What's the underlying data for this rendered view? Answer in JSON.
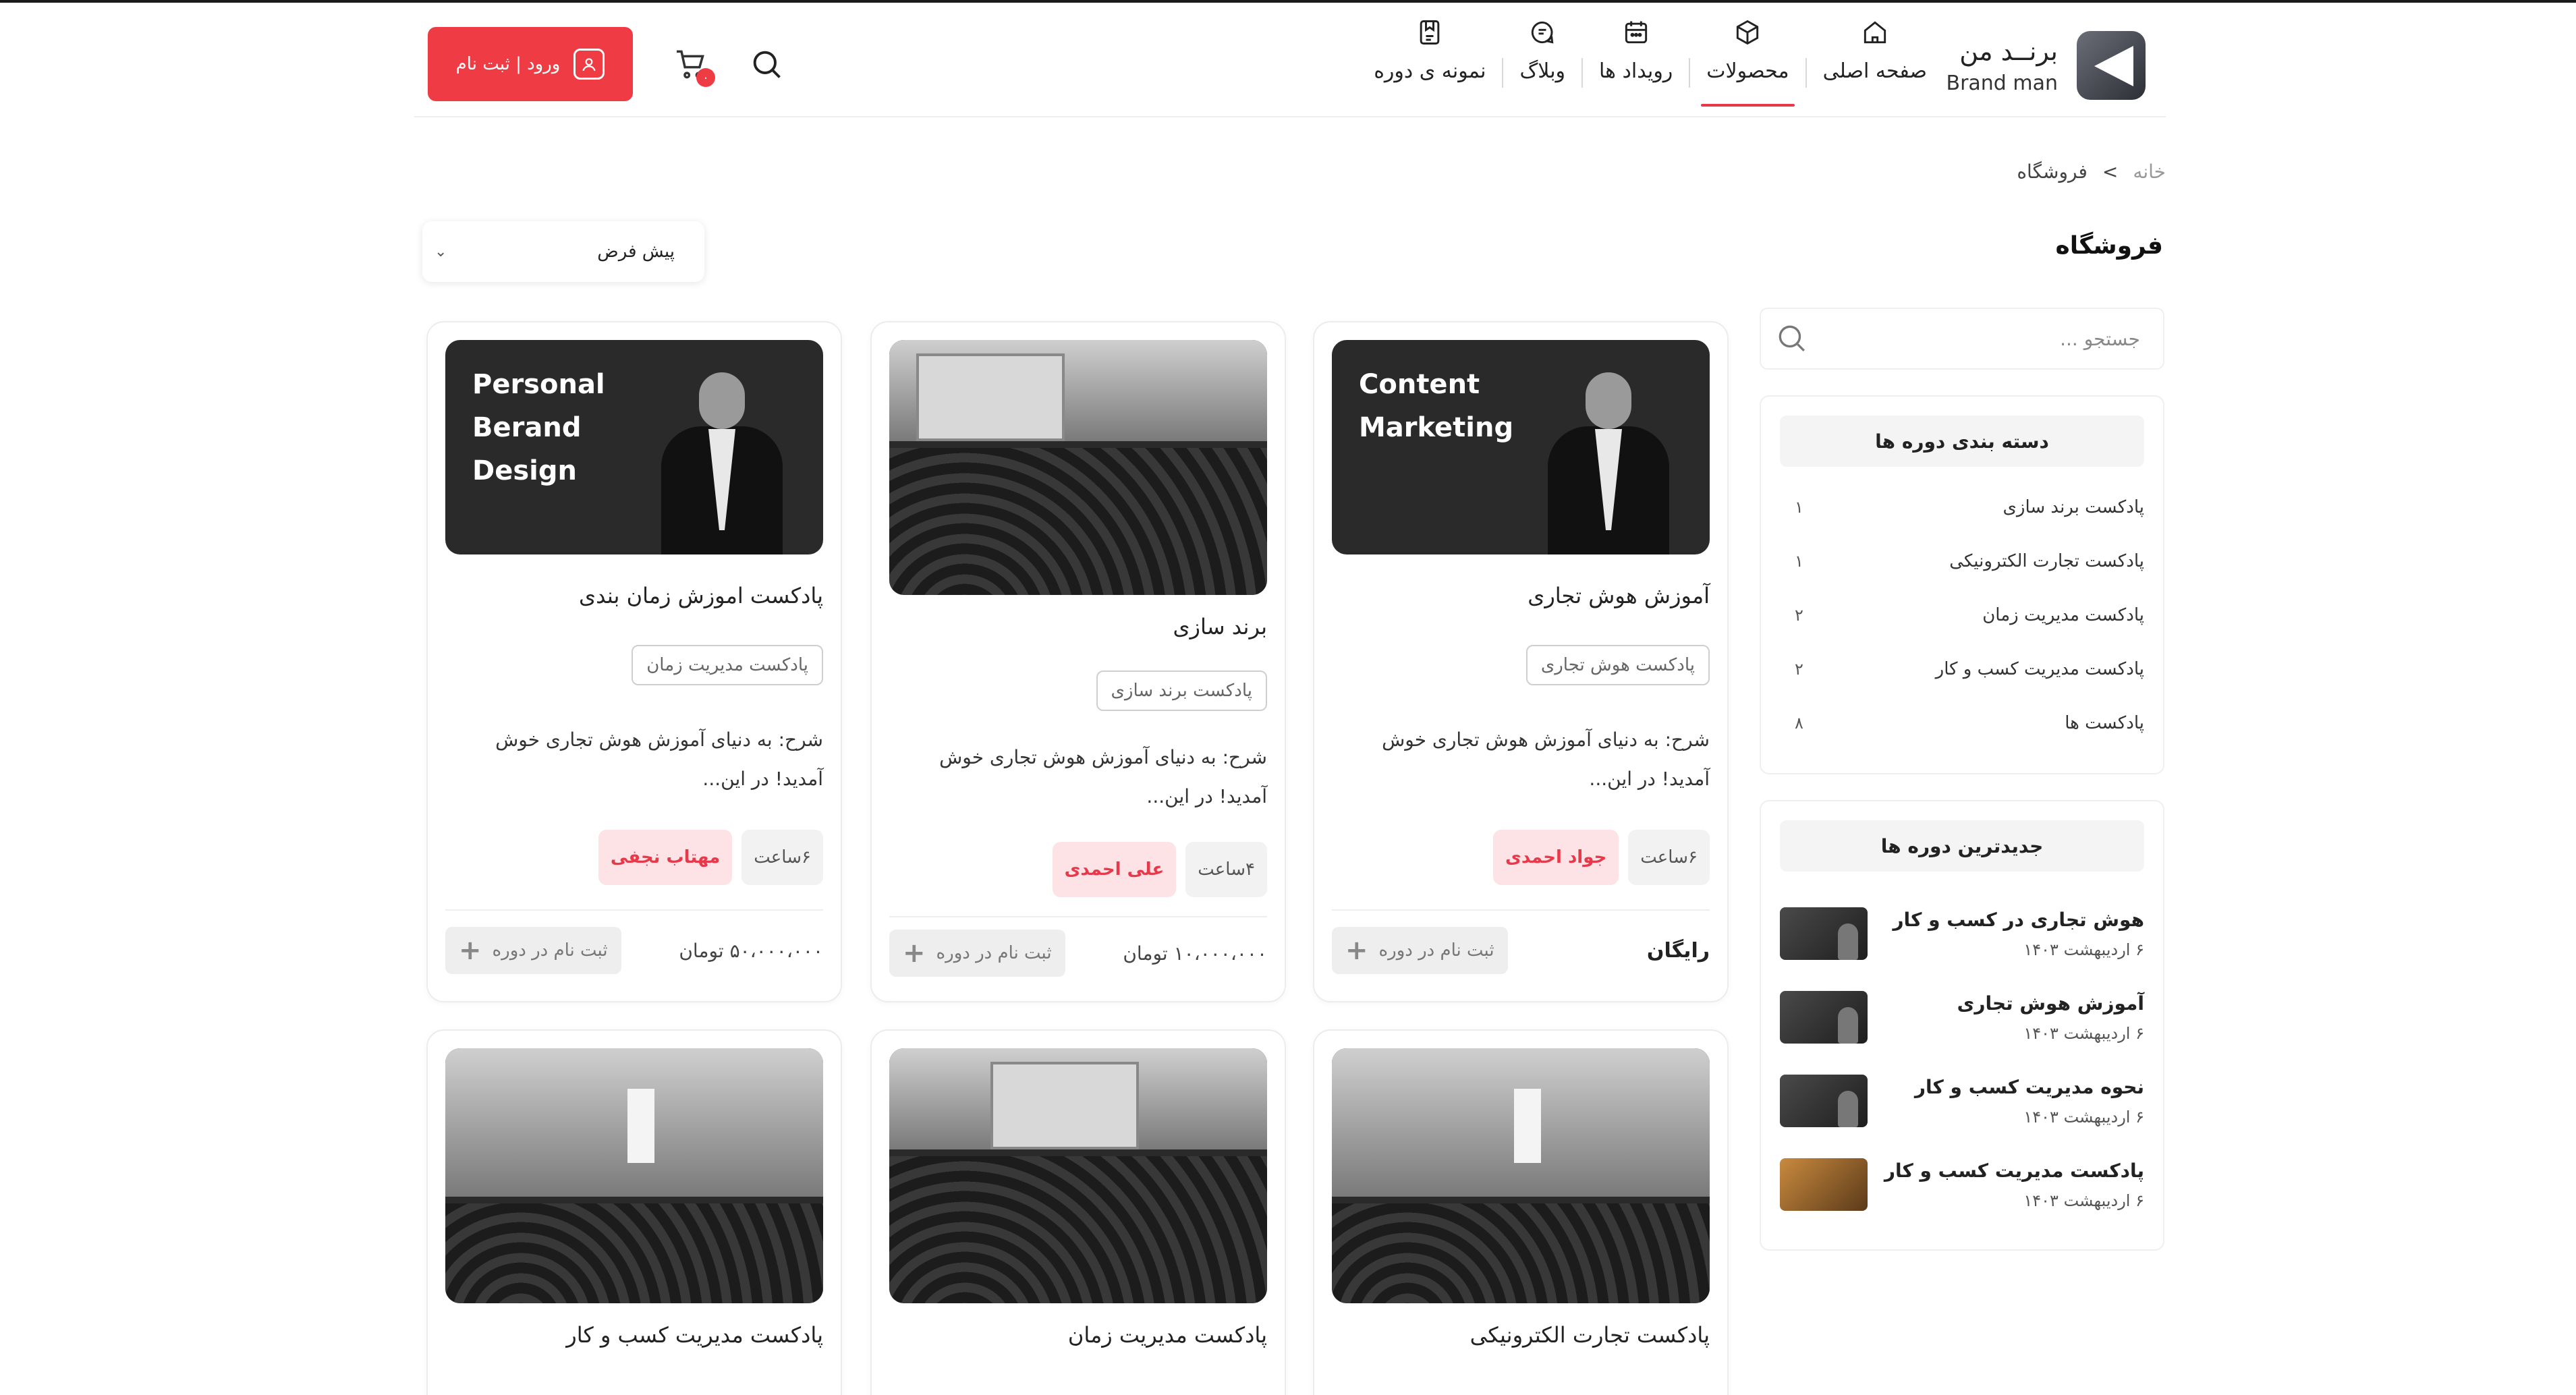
{
  "brand": {
    "name_fa": "برنــد من",
    "name_en": "Brand man"
  },
  "nav": [
    {
      "label": "صفحه اصلی",
      "icon": "home-icon",
      "active": false
    },
    {
      "label": "محصولات",
      "icon": "box-icon",
      "active": true
    },
    {
      "label": "رویداد ها",
      "icon": "calendar-icon",
      "active": false
    },
    {
      "label": "وبلاگ",
      "icon": "blog-icon",
      "active": false
    },
    {
      "label": "نمونه ی دوره",
      "icon": "course-sample-icon",
      "active": false
    }
  ],
  "header": {
    "login_label": "ورود | ثبت نام",
    "cart_count": "۰"
  },
  "breadcrumb": {
    "home": "خانه",
    "separator": ">",
    "current": "فروشگاه"
  },
  "page": {
    "title": "فروشگاه"
  },
  "sort": {
    "selected": "پیش فرض"
  },
  "sidebar": {
    "search_placeholder": "جستجو ...",
    "categories_title": "دسته بندی دوره ها",
    "categories": [
      {
        "name": "پادکست برند سازی",
        "count": "۱"
      },
      {
        "name": "پادکست تجارت الکترونیکی",
        "count": "۱"
      },
      {
        "name": "پادکست مدیریت زمان",
        "count": "۲"
      },
      {
        "name": "پادکست مدیریت کسب و کار",
        "count": "۲"
      },
      {
        "name": "پادکست ها",
        "count": "۸"
      }
    ],
    "recent_title": "جدیدترین دوره ها",
    "recent": [
      {
        "title": "هوش تجاری در کسب و کار",
        "date": "۶ اردیبهشت ۱۴۰۳"
      },
      {
        "title": "آموزش هوش تجاری",
        "date": "۶ اردیبهشت ۱۴۰۳"
      },
      {
        "title": "نحوه مدیریت کسب و کار",
        "date": "۶ اردیبهشت ۱۴۰۳"
      },
      {
        "title": "پادکست مدیریت کسب و کار",
        "date": "۶ اردیبهشت ۱۴۰۳"
      }
    ]
  },
  "products": [
    {
      "image_text": [
        "Content",
        "Marketing"
      ],
      "title": "آموزش هوش تجاری",
      "tag": "پادکست هوش تجاری",
      "desc": "شرح: به دنیای آموزش هوش تجاری خوش آمدید! در این...",
      "duration": "۶ساعت",
      "author": "جواد احمدی",
      "enroll": "ثبت نام در دوره",
      "price": "رایگان"
    },
    {
      "image_text": [],
      "title": "برند سازی",
      "tag": "پادکست برند سازی",
      "desc": "شرح: به دنیای آموزش هوش تجاری خوش آمدید! در این...",
      "duration": "۴ساعت",
      "author": "علی احمدی",
      "enroll": "ثبت نام در دوره",
      "price": "۱۰،۰۰۰،۰۰۰ تومان"
    },
    {
      "image_text": [
        "Personal",
        "Berand",
        "Design"
      ],
      "title": "پادکست اموزش زمان بندی",
      "tag": "پادکست مدیریت زمان",
      "desc": "شرح: به دنیای آموزش هوش تجاری خوش آمدید! در این...",
      "duration": "۶ساعت",
      "author": "مهتاب نجفی",
      "enroll": "ثبت نام در دوره",
      "price": "۵۰،۰۰۰،۰۰۰ تومان"
    },
    {
      "title": "پادکست تجارت الکترونیکی"
    },
    {
      "title": "پادکست مدیریت زمان"
    },
    {
      "title": "پادکست مدیریت کسب و کار"
    }
  ],
  "colors": {
    "accent": "#ef3b43",
    "author_bg": "#fde3e5",
    "dark": "#1a1a1a"
  }
}
